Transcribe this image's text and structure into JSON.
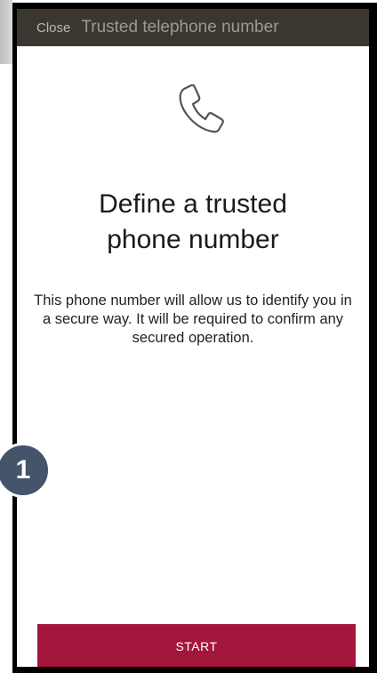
{
  "topbar": {
    "close_label": "Close",
    "title": "Trusted telephone number"
  },
  "main": {
    "icon": "phone-icon",
    "heading_line1": "Define a trusted",
    "heading_line2": "phone number",
    "description": "This phone number will allow us to identify you in a secure way. It will be required to confirm any secured operation."
  },
  "footer": {
    "start_label": "START"
  },
  "annotation": {
    "step_number": "1"
  },
  "colors": {
    "topbar_bg": "#3c3631",
    "accent": "#a3163b",
    "badge_bg": "#44546a"
  }
}
